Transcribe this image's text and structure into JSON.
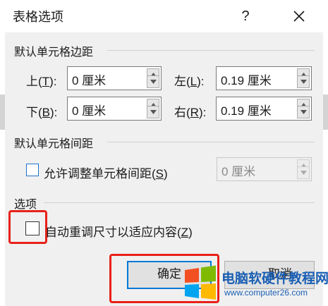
{
  "dialog": {
    "title": "表格选项",
    "help_label": "?",
    "close_icon": "close-icon"
  },
  "margins": {
    "section_title": "默认单元格边距",
    "top": {
      "label": "上(",
      "key": "T",
      "suffix": "):",
      "value": "0 厘米"
    },
    "bottom": {
      "label": "下(",
      "key": "B",
      "suffix": "):",
      "value": "0 厘米"
    },
    "left": {
      "label": "左(",
      "key": "L",
      "suffix": "):",
      "value": "0.19 厘米"
    },
    "right": {
      "label": "右(",
      "key": "R",
      "suffix": "):",
      "value": "0.19 厘米"
    }
  },
  "spacing": {
    "section_title": "默认单元格间距",
    "checkbox_label": "允许调整单元格间距(",
    "checkbox_key": "S",
    "checkbox_suffix": ")",
    "checked": false,
    "value": "0 厘米"
  },
  "options": {
    "section_title": "选项",
    "autofit_label": "自动重调尺寸以适应内容(",
    "autofit_key": "Z",
    "autofit_suffix": ")",
    "checked": false
  },
  "buttons": {
    "ok": "确定",
    "cancel": "取消"
  },
  "watermark": {
    "text": "电脑软硬件教程网",
    "url": "www.computer26.com"
  },
  "colors": {
    "highlight": "#e8211a",
    "focus_border": "#0078d7",
    "dialog_bg": "#f0f0f0"
  }
}
